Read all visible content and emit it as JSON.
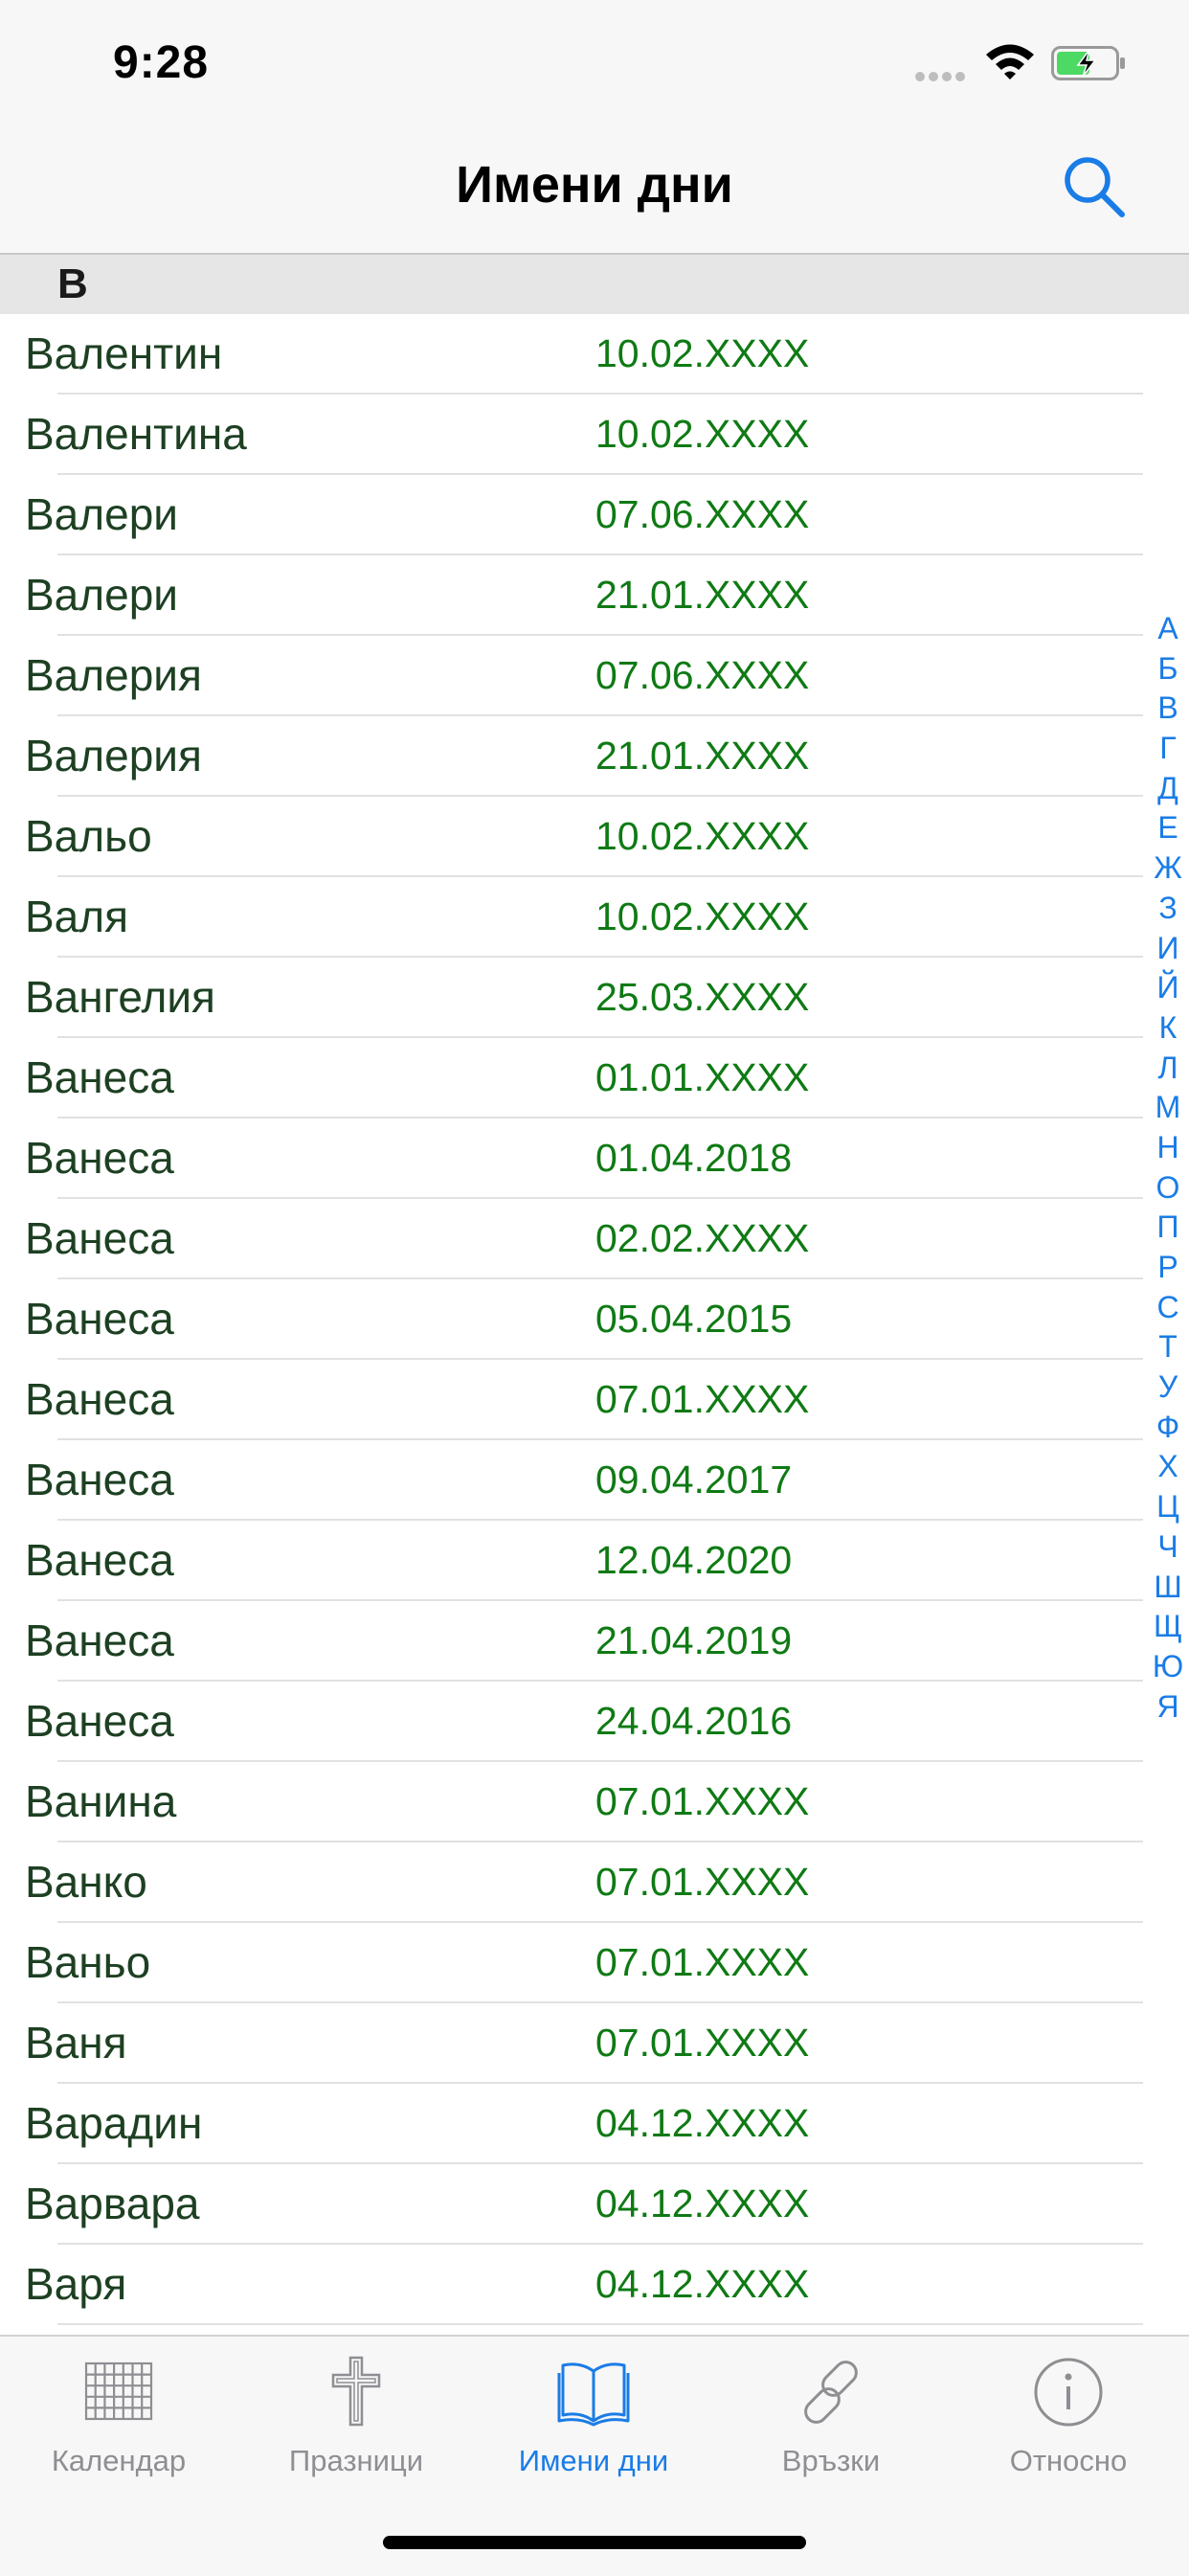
{
  "status_bar": {
    "time": "9:28"
  },
  "nav": {
    "title": "Имени дни"
  },
  "section": {
    "letter": "В"
  },
  "entries": [
    {
      "name": "Валентин",
      "date": "10.02.XXXX"
    },
    {
      "name": "Валентина",
      "date": "10.02.XXXX"
    },
    {
      "name": "Валери",
      "date": "07.06.XXXX"
    },
    {
      "name": "Валери",
      "date": "21.01.XXXX"
    },
    {
      "name": "Валерия",
      "date": "07.06.XXXX"
    },
    {
      "name": "Валерия",
      "date": "21.01.XXXX"
    },
    {
      "name": "Вальо",
      "date": "10.02.XXXX"
    },
    {
      "name": "Валя",
      "date": "10.02.XXXX"
    },
    {
      "name": "Вангелия",
      "date": "25.03.XXXX"
    },
    {
      "name": "Ванеса",
      "date": "01.01.XXXX"
    },
    {
      "name": "Ванеса",
      "date": "01.04.2018"
    },
    {
      "name": "Ванеса",
      "date": "02.02.XXXX"
    },
    {
      "name": "Ванеса",
      "date": "05.04.2015"
    },
    {
      "name": "Ванеса",
      "date": "07.01.XXXX"
    },
    {
      "name": "Ванеса",
      "date": "09.04.2017"
    },
    {
      "name": "Ванеса",
      "date": "12.04.2020"
    },
    {
      "name": "Ванеса",
      "date": "21.04.2019"
    },
    {
      "name": "Ванеса",
      "date": "24.04.2016"
    },
    {
      "name": "Ванина",
      "date": "07.01.XXXX"
    },
    {
      "name": "Ванко",
      "date": "07.01.XXXX"
    },
    {
      "name": "Ваньо",
      "date": "07.01.XXXX"
    },
    {
      "name": "Ваня",
      "date": "07.01.XXXX"
    },
    {
      "name": "Варадин",
      "date": "04.12.XXXX"
    },
    {
      "name": "Варвара",
      "date": "04.12.XXXX"
    },
    {
      "name": "Варя",
      "date": "04.12.XXXX"
    }
  ],
  "index_letters": [
    "А",
    "Б",
    "В",
    "Г",
    "Д",
    "Е",
    "Ж",
    "З",
    "И",
    "Й",
    "К",
    "Л",
    "М",
    "Н",
    "О",
    "П",
    "Р",
    "С",
    "Т",
    "У",
    "Ф",
    "Х",
    "Ц",
    "Ч",
    "Ш",
    "Щ",
    "Ю",
    "Я"
  ],
  "tabs": [
    {
      "id": "calendar",
      "label": "Календар",
      "icon": "calendar-grid-icon",
      "active": false
    },
    {
      "id": "holidays",
      "label": "Празници",
      "icon": "cross-icon",
      "active": false
    },
    {
      "id": "namedays",
      "label": "Имени дни",
      "icon": "open-book-icon",
      "active": true
    },
    {
      "id": "links",
      "label": "Връзки",
      "icon": "link-icon",
      "active": false
    },
    {
      "id": "about",
      "label": "Относно",
      "icon": "info-icon",
      "active": false
    }
  ],
  "colors": {
    "accent": "#1a7ce6",
    "name_text": "#1d4022",
    "date_text": "#0f7a14",
    "tab_inactive": "#8e8e93",
    "battery_fill": "#4cd964"
  }
}
